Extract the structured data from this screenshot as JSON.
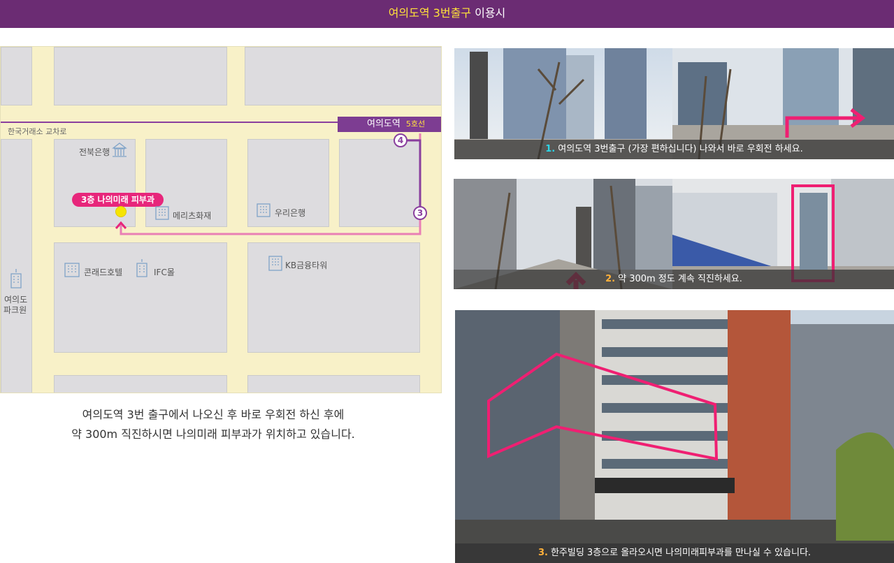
{
  "header": {
    "title_highlight": "여의도역 3번출구",
    "title_rest": "이용시"
  },
  "map": {
    "road_label": "한국거래소 교차로",
    "station": {
      "name": "여의도역",
      "line": "5호선"
    },
    "steps": [
      "4",
      "3"
    ],
    "clinic_label": "3층 나의미래 피부과",
    "places": {
      "jeonbuk": "전북은행",
      "meritz": "메리츠화재",
      "woori": "우리은행",
      "conrad": "콘래드호텔",
      "ifc": "IFC몰",
      "kb": "KB금융타워",
      "park_line1": "여의도",
      "park_line2": "파크원"
    },
    "colors": {
      "route": "#8a3f9e",
      "walk": "#e97fb5",
      "clinic": "#e7267b",
      "dot": "#f6e400"
    }
  },
  "description": {
    "line1": "여의도역 3번 출구에서 나오신 후 바로 우회전 하신 후에",
    "line2": "약 300m 직진하시면 나의미래 피부과가 위치하고 있습니다."
  },
  "photos": [
    {
      "num": "1.",
      "text": "여의도역 3번출구 (가장 편하십니다) 나와서 바로 우회전 하세요."
    },
    {
      "num": "2.",
      "text": "약 300m 정도 계속 직진하세요."
    },
    {
      "num": "3.",
      "text": "한주빌딩 3층으로 올라오시면 나의미래피부과를 만나실 수 있습니다."
    }
  ]
}
